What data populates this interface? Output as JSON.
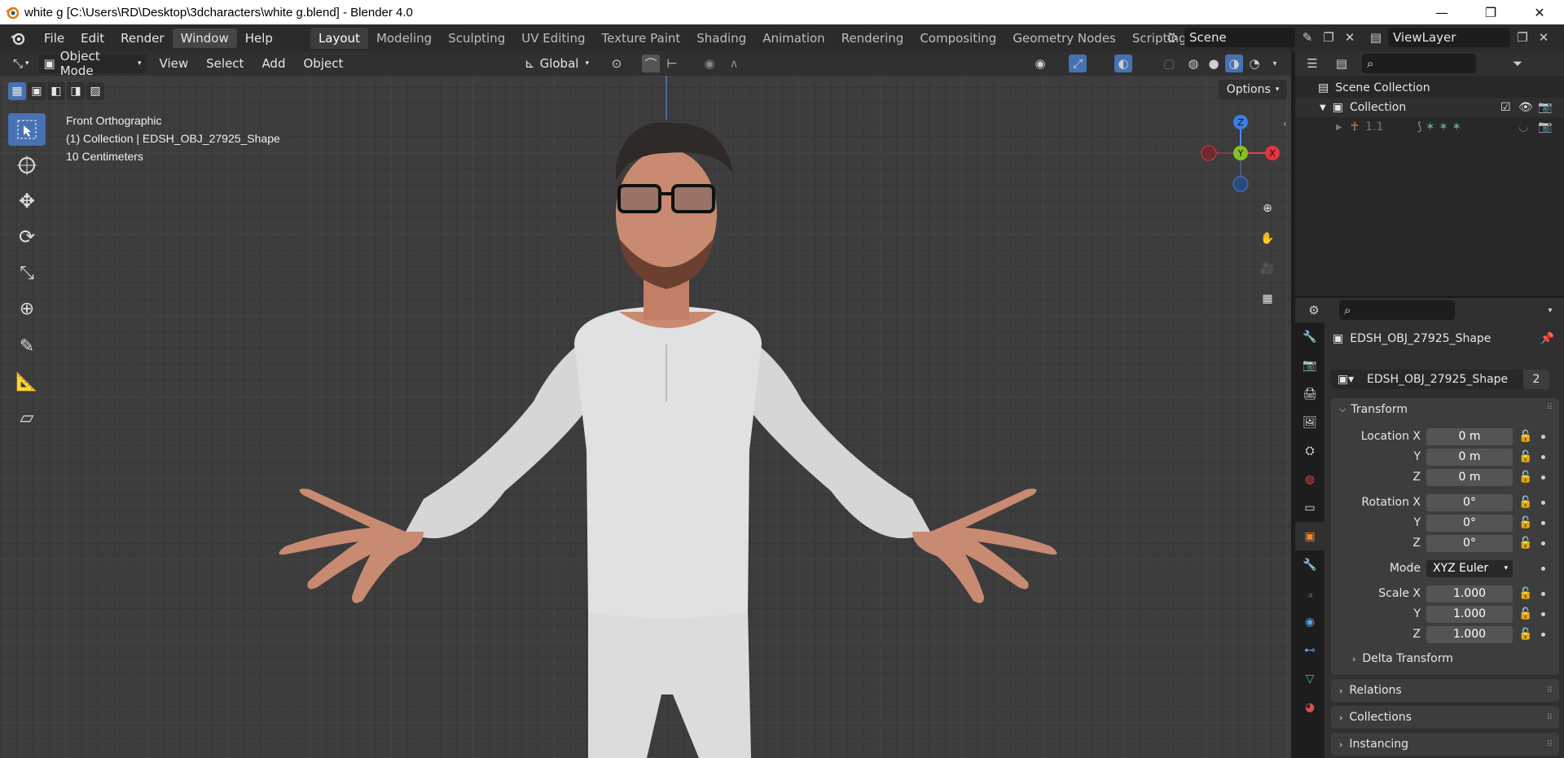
{
  "window": {
    "title": "white g [C:\\Users\\RD\\Desktop\\3dcharacters\\white g.blend] - Blender 4.0"
  },
  "menu": {
    "items": [
      "File",
      "Edit",
      "Render",
      "Window",
      "Help"
    ],
    "active": "Window"
  },
  "workspaces": {
    "tabs": [
      "Layout",
      "Modeling",
      "Sculpting",
      "UV Editing",
      "Texture Paint",
      "Shading",
      "Animation",
      "Rendering",
      "Compositing",
      "Geometry Nodes",
      "Scripting"
    ],
    "active": "Layout",
    "add_label": "+"
  },
  "scene": {
    "name": "Scene"
  },
  "view_layer": {
    "name": "ViewLayer"
  },
  "viewport_header": {
    "mode": "Object Mode",
    "menus": [
      "View",
      "Select",
      "Add",
      "Object"
    ],
    "orientation": "Global"
  },
  "viewport": {
    "view_name": "Front Orthographic",
    "collection_info": "(1) Collection | EDSH_OBJ_27925_Shape",
    "scale_info": "10 Centimeters",
    "options_label": "Options",
    "gizmo": {
      "z": "Z",
      "y": "Y",
      "x": "X"
    }
  },
  "outliner": {
    "root": "Scene Collection",
    "collection": "Collection",
    "object": "1.1"
  },
  "properties": {
    "object_name": "EDSH_OBJ_27925_Shape",
    "data_name": "EDSH_OBJ_27925_Shape",
    "users": "2",
    "transform": {
      "title": "Transform",
      "location_label": "Location X",
      "rotation_label": "Rotation X",
      "scale_label": "Scale X",
      "y": "Y",
      "z": "Z",
      "location": [
        "0 m",
        "0 m",
        "0 m"
      ],
      "rotation": [
        "0°",
        "0°",
        "0°"
      ],
      "mode_label": "Mode",
      "mode": "XYZ Euler",
      "scale": [
        "1.000",
        "1.000",
        "1.000"
      ],
      "delta": "Delta Transform"
    },
    "relations": "Relations",
    "collections": "Collections",
    "instancing": "Instancing"
  }
}
